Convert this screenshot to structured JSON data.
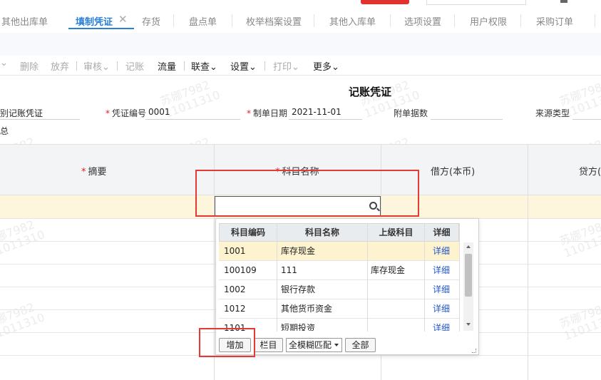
{
  "tabs": [
    {
      "label": "其他出库单"
    },
    {
      "label": "填制凭证"
    },
    {
      "label": "存货"
    },
    {
      "label": "盘点单"
    },
    {
      "label": "枚举档案设置"
    },
    {
      "label": "其他入库单"
    },
    {
      "label": "选项设置"
    },
    {
      "label": "用户权限"
    },
    {
      "label": "采购订单"
    }
  ],
  "tab_close": "✕",
  "toolbar": {
    "caret": "⌄",
    "delete": "删除",
    "discard": "放弃",
    "audit": "审核⌄",
    "post": "记账",
    "cash_flow": "流量",
    "link_query": "联查⌄",
    "settings": "设置⌄",
    "print": "打印⌄",
    "more": "更多⌄"
  },
  "form": {
    "title": "记账凭证",
    "type_label": "别",
    "type_value": "记账凭证",
    "number_label": "凭证编号",
    "number_value": "0001",
    "date_label": "制单日期",
    "date_value": "2021-11-01",
    "attach_label": "附单据数",
    "source_label": "来源类型",
    "extra_label": "总"
  },
  "table": {
    "headers": {
      "summary": "摘要",
      "subject": "科目名称",
      "debit": "借方(本币)",
      "credit": "贷方("
    }
  },
  "dropdown": {
    "headers": [
      "科目编码",
      "科目名称",
      "上级科目",
      "详细"
    ],
    "rows": [
      {
        "code": "1001",
        "name": "库存现金",
        "parent": "",
        "detail": "详细"
      },
      {
        "code": "100109",
        "name": "111",
        "parent": "库存现金",
        "detail": "详细"
      },
      {
        "code": "1002",
        "name": "银行存款",
        "parent": "",
        "detail": "详细"
      },
      {
        "code": "1012",
        "name": "其他货币资金",
        "parent": "",
        "detail": "详细"
      },
      {
        "code": "1101",
        "name": "短期投资",
        "parent": "",
        "detail": "详细"
      }
    ],
    "add_button": "增加",
    "columns_button": "栏目",
    "match_mode": "全模糊匹配",
    "all_button": "全部"
  },
  "watermark": {
    "line1": "苏娜7982",
    "line2": "11011310"
  },
  "colors": {
    "accent": "#2a7fd6",
    "highlight_box": "#e53935",
    "selected_row": "#fdf6dc"
  }
}
